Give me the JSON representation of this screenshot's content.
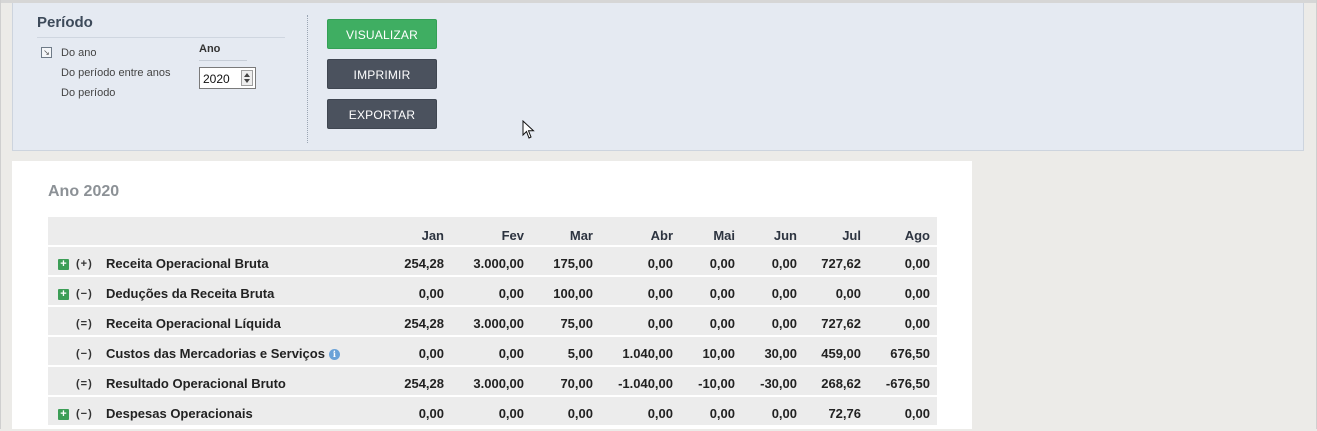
{
  "filter": {
    "title": "Período",
    "options": [
      "Do ano",
      "Do período entre anos",
      "Do período"
    ],
    "year_label": "Ano",
    "year_value": "2020",
    "buttons": {
      "visualize": "VISUALIZAR",
      "print": "IMPRIMIR",
      "export": "EXPORTAR"
    }
  },
  "report": {
    "title": "Ano 2020",
    "columns": [
      "Jan",
      "Fev",
      "Mar",
      "Abr",
      "Mai",
      "Jun",
      "Jul",
      "Ago"
    ],
    "rows": [
      {
        "sign": "(+)",
        "label": "Receita Operacional Bruta",
        "expandable": true,
        "info": false,
        "values": [
          "254,28",
          "3.000,00",
          "175,00",
          "0,00",
          "0,00",
          "0,00",
          "727,62",
          "0,00"
        ]
      },
      {
        "sign": "(−)",
        "label": "Deduções da Receita Bruta",
        "expandable": true,
        "info": false,
        "values": [
          "0,00",
          "0,00",
          "100,00",
          "0,00",
          "0,00",
          "0,00",
          "0,00",
          "0,00"
        ]
      },
      {
        "sign": "(=)",
        "label": "Receita Operacional Líquida",
        "expandable": false,
        "info": false,
        "values": [
          "254,28",
          "3.000,00",
          "75,00",
          "0,00",
          "0,00",
          "0,00",
          "727,62",
          "0,00"
        ]
      },
      {
        "sign": "(−)",
        "label": "Custos das Mercadorias e Serviços",
        "expandable": false,
        "info": true,
        "values": [
          "0,00",
          "0,00",
          "5,00",
          "1.040,00",
          "10,00",
          "30,00",
          "459,00",
          "676,50"
        ]
      },
      {
        "sign": "(=)",
        "label": "Resultado Operacional Bruto",
        "expandable": false,
        "info": false,
        "values": [
          "254,28",
          "3.000,00",
          "70,00",
          "-1.040,00",
          "-10,00",
          "-30,00",
          "268,62",
          "-676,50"
        ]
      },
      {
        "sign": "(−)",
        "label": "Despesas Operacionais",
        "expandable": true,
        "info": false,
        "values": [
          "0,00",
          "0,00",
          "0,00",
          "0,00",
          "0,00",
          "0,00",
          "72,76",
          "0,00"
        ]
      }
    ]
  },
  "colors": {
    "green": "#3fae62",
    "dark_button": "#4b525e",
    "panel": "#e5eaf2",
    "row": "#ececec"
  }
}
